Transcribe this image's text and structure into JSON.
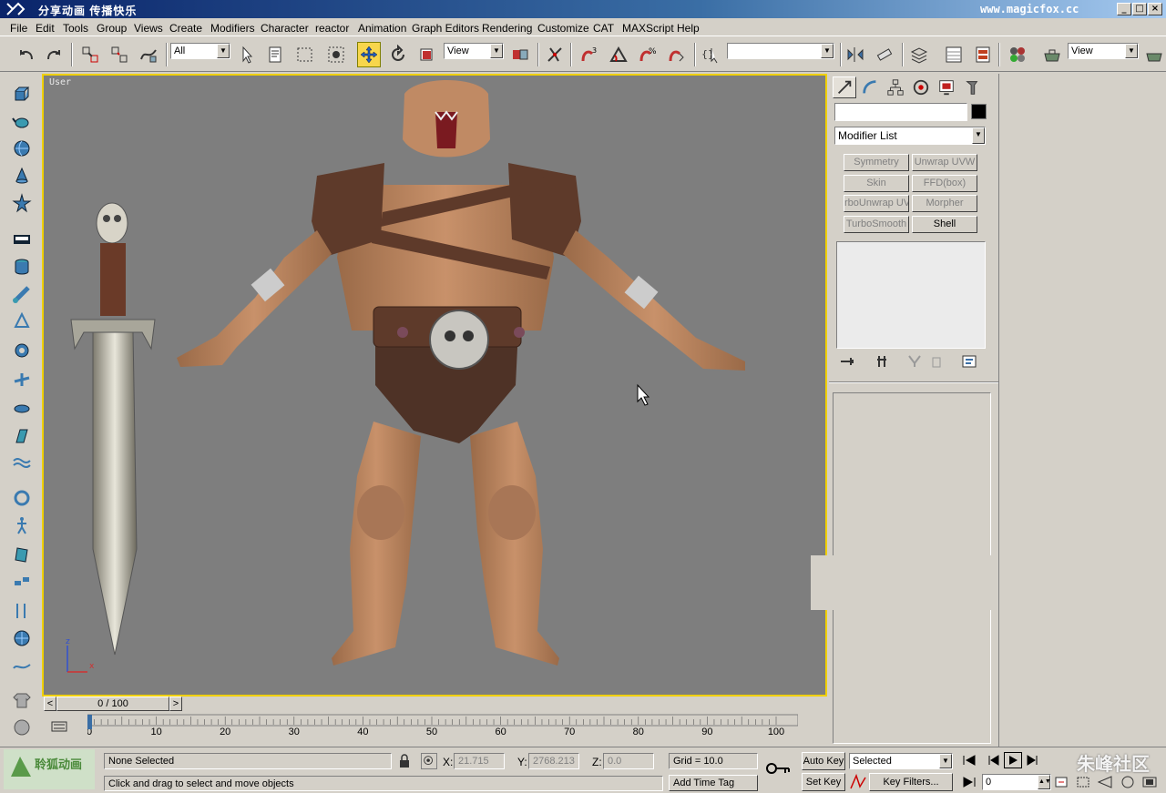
{
  "window": {
    "title": "分享动画   传播快乐",
    "url": "www.magicfox.cc",
    "controls": [
      "_",
      "□",
      "×"
    ]
  },
  "menu": [
    "File",
    "Edit",
    "Tools",
    "Group",
    "Views",
    "Create",
    "Modifiers",
    "Character",
    "reactor",
    "Animation",
    "Graph Editors",
    "Rendering",
    "Customize",
    "CAT",
    "MAXScript",
    "Help"
  ],
  "toolbar": {
    "selection_filter": "All",
    "ref_coord": "View",
    "named_selection": "",
    "render_view": "View"
  },
  "viewport": {
    "label": "User",
    "axis_x": "x",
    "axis_z": "z"
  },
  "command_panel": {
    "name_field": "",
    "modifier_list": "Modifier List",
    "modifier_buttons": [
      "Symmetry",
      "Unwrap UVW",
      "Skin",
      "FFD(box)",
      "rboUnwrap UV",
      "Morpher",
      "TurboSmooth",
      "Shell"
    ]
  },
  "timeline": {
    "frame_display": "0 / 100",
    "prev": "<",
    "next": ">"
  },
  "trackbar": {
    "ticks": [
      "0",
      "10",
      "20",
      "30",
      "40",
      "50",
      "60",
      "70",
      "80",
      "90",
      "100"
    ]
  },
  "status": {
    "selection": "None Selected",
    "prompt": "Click and drag to select and move objects",
    "x_label": "X:",
    "x_value": "21.715",
    "y_label": "Y:",
    "y_value": "2768.213",
    "z_label": "Z:",
    "z_value": "0.0",
    "grid": "Grid = 10.0",
    "add_time_tag": "Add Time Tag",
    "auto_key": "Auto Key",
    "set_key": "Set Key",
    "key_mode": "Selected",
    "key_filters": "Key Filters...",
    "current_frame": "0"
  },
  "watermark": {
    "logo_text": "聆狐动画",
    "community": "朱峰社区"
  }
}
